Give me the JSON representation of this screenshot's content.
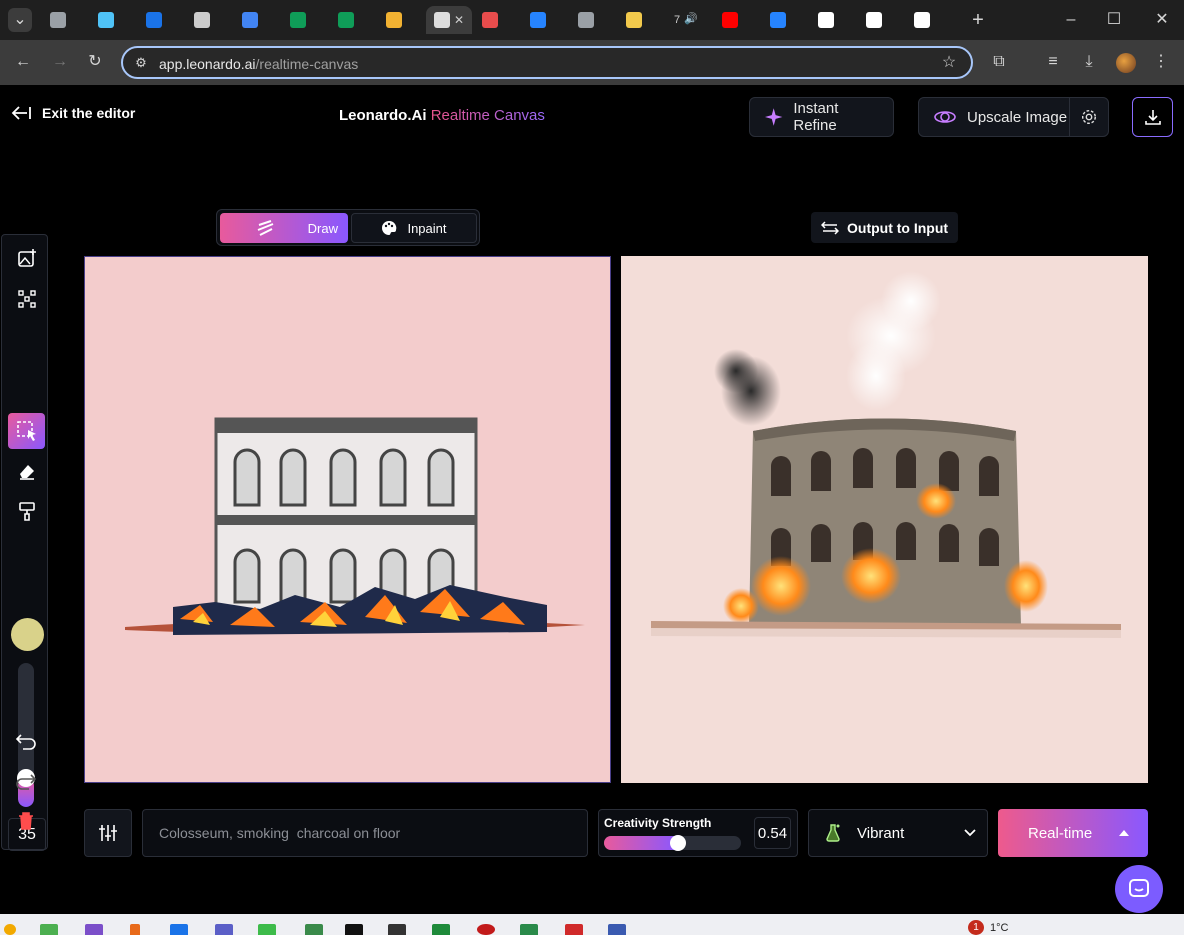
{
  "browser": {
    "url_host": "app.leonardo.ai",
    "url_path": "/realtime-canvas",
    "tabs": [
      {
        "icon": "generic-tab-icon",
        "color": "#9aa0a6"
      },
      {
        "icon": "extension-tab-icon",
        "color": "#4fc3f7"
      },
      {
        "icon": "puzzle-tab-icon",
        "color": "#1a73e8"
      },
      {
        "icon": "openai-tab-icon",
        "color": "#cccccc"
      },
      {
        "icon": "translate-tab-icon",
        "color": "#4285f4"
      },
      {
        "icon": "sheets-tab-icon",
        "color": "#0f9d58"
      },
      {
        "icon": "sheets-tab-icon",
        "color": "#0f9d58"
      },
      {
        "icon": "leonardo-tab-icon",
        "color": "#f2b232"
      },
      {
        "icon": "active-tab-icon",
        "color": "#dddddd"
      },
      {
        "icon": "app-tab-icon",
        "color": "#e84c4c"
      },
      {
        "icon": "jira-tab-icon",
        "color": "#2684ff"
      },
      {
        "icon": "globe-tab-icon",
        "color": "#9aa0a6"
      },
      {
        "icon": "emoji-tab-icon",
        "color": "#f2c94c"
      },
      {
        "icon": "audio-tab-icon",
        "color": "#dddddd"
      },
      {
        "icon": "youtube-tab-icon",
        "color": "#ff0000"
      },
      {
        "icon": "jira-tab-icon",
        "color": "#2684ff"
      },
      {
        "icon": "wikipedia-tab-icon",
        "color": "#ffffff"
      },
      {
        "icon": "google-tab-icon",
        "color": "#ffffff"
      },
      {
        "icon": "google-tab-icon",
        "color": "#ffffff"
      }
    ],
    "tab_audio_text": "7"
  },
  "header": {
    "exit_label": "Exit the editor",
    "brand": "Leonardo.Ai",
    "product": "Realtime Canvas",
    "instant_refine_label": "Instant Refine",
    "upscale_label": "Upscale Image"
  },
  "modes": {
    "draw_label": "Draw",
    "inpaint_label": "Inpaint",
    "active": "draw"
  },
  "output_to_input_label": "Output to Input",
  "toolbar": {
    "tools": [
      "add-image",
      "object-select",
      "select",
      "eraser",
      "paint-bucket"
    ],
    "active_tool": "select",
    "brush_color": "#d9d28a",
    "brush_size": "35",
    "brush_level": 0.2
  },
  "bottom": {
    "prompt_value": "Colosseum, smoking  charcoal on floor",
    "creativity_label": "Creativity Strength",
    "creativity_value": "0.54",
    "creativity_level": 0.54,
    "style_label": "Vibrant",
    "realtime_label": "Real-time"
  },
  "taskbar": {
    "notification_count": "1",
    "temperature": "1°C"
  },
  "colors": {
    "accent_pink": "#e85a9c",
    "accent_purple": "#8a58ff",
    "input_canvas_bg": "#f3cccc",
    "output_canvas_bg": "#f3ddd8"
  }
}
